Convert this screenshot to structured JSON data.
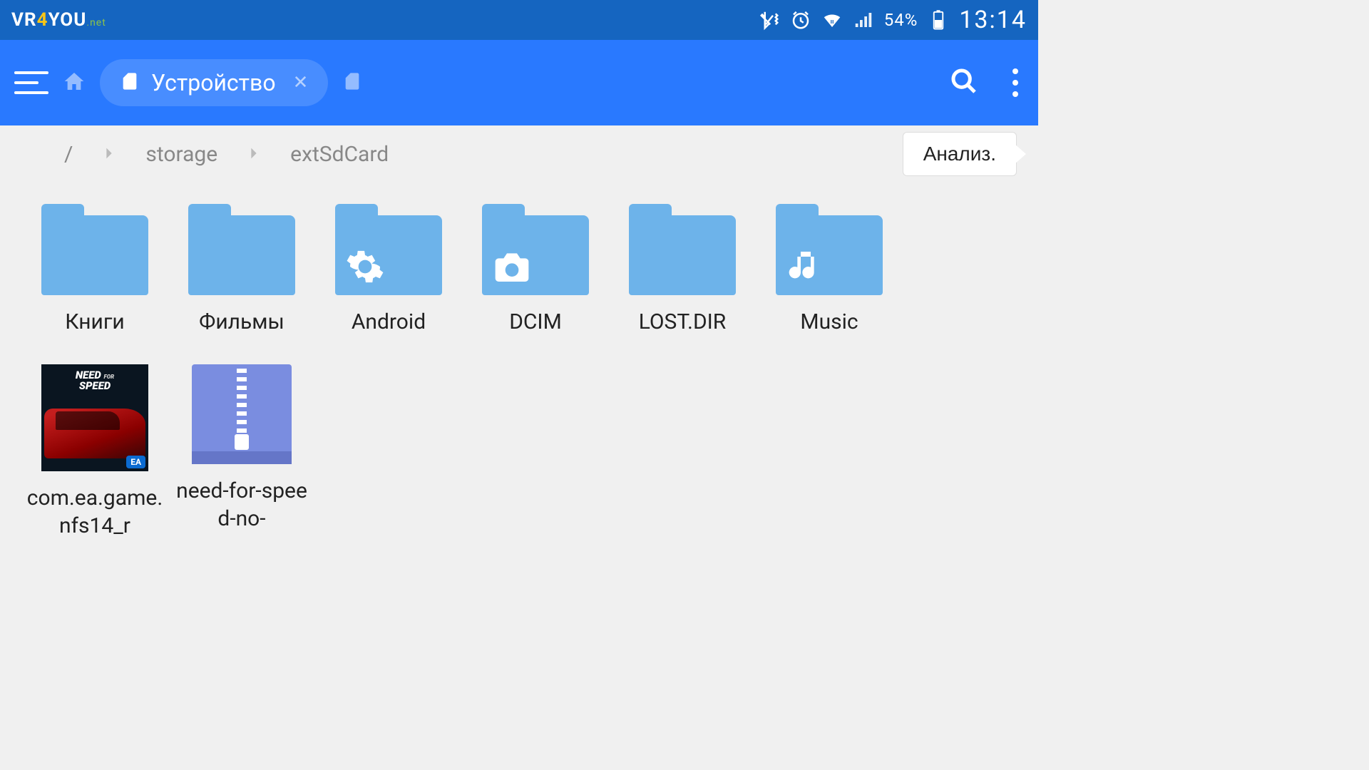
{
  "status": {
    "logo_prefix": "VR",
    "logo_highlight": "4",
    "logo_suffix": "YOU",
    "logo_tld": ".net",
    "battery": "54%",
    "time": "13:14"
  },
  "appbar": {
    "tab_label": "Устройство"
  },
  "breadcrumb": {
    "root": "/",
    "parts": [
      "storage",
      "extSdCard"
    ],
    "analyze_label": "Анализ."
  },
  "files": [
    {
      "name": "Книги",
      "type": "folder",
      "overlay": null
    },
    {
      "name": "Фильмы",
      "type": "folder",
      "overlay": null
    },
    {
      "name": "Android",
      "type": "folder",
      "overlay": "gear"
    },
    {
      "name": "DCIM",
      "type": "folder",
      "overlay": "camera"
    },
    {
      "name": "LOST.DIR",
      "type": "folder",
      "overlay": null
    },
    {
      "name": "Music",
      "type": "folder",
      "overlay": "music"
    },
    {
      "name": "com.ea.game.nfs14_r",
      "type": "nfs",
      "overlay": null
    },
    {
      "name": "need-for-speed-no-",
      "type": "zip",
      "overlay": null
    }
  ],
  "nfs_thumb": {
    "line1": "NEED",
    "for": "FOR",
    "line2": "SPEED",
    "badge": "EA"
  }
}
